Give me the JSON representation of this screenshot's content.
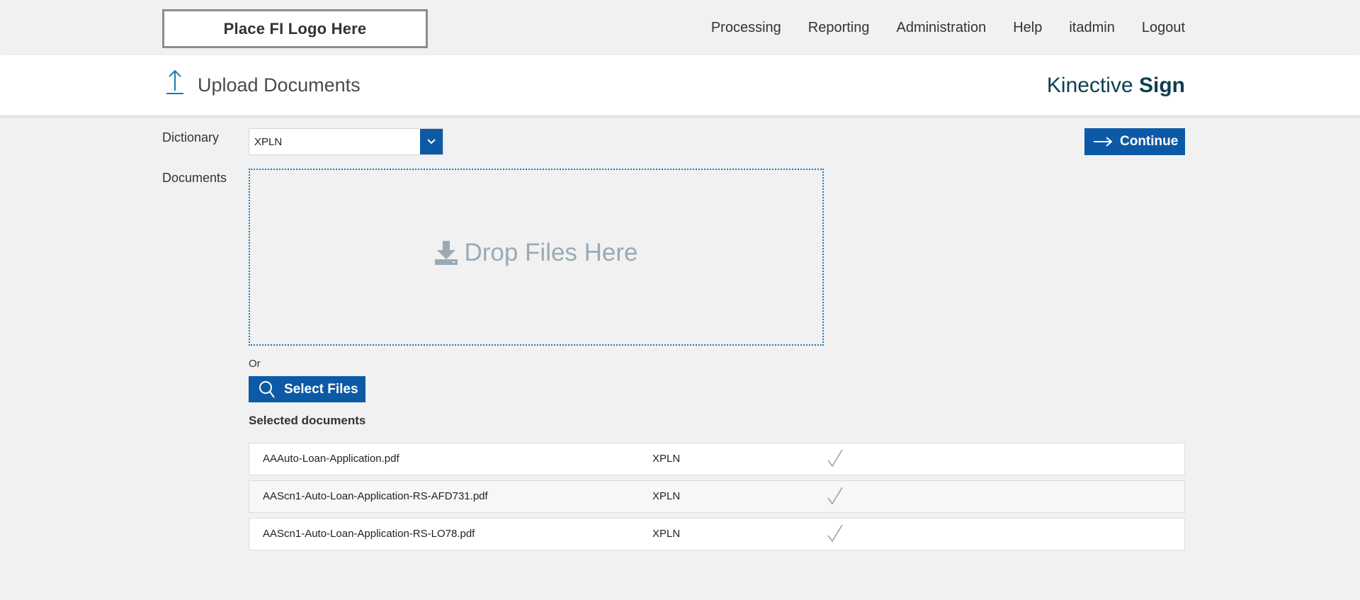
{
  "header": {
    "logo_text": "Place FI Logo Here",
    "nav": [
      "Processing",
      "Reporting",
      "Administration",
      "Help",
      "itadmin",
      "Logout"
    ]
  },
  "titlebar": {
    "title": "Upload Documents",
    "brand_regular": "Kinective ",
    "brand_bold": "Sign"
  },
  "form": {
    "dictionary_label": "Dictionary",
    "dictionary_value": "XPLN",
    "documents_label": "Documents",
    "continue_label": "Continue",
    "drop_text": "Drop Files Here",
    "or_text": "Or",
    "select_files_label": "Select Files",
    "selected_title": "Selected documents"
  },
  "documents": [
    {
      "name": "AAAuto-Loan-Application.pdf",
      "dictionary": "XPLN"
    },
    {
      "name": "AAScn1-Auto-Loan-Application-RS-AFD731.pdf",
      "dictionary": "XPLN"
    },
    {
      "name": "AAScn1-Auto-Loan-Application-RS-LO78.pdf",
      "dictionary": "XPLN"
    }
  ],
  "colors": {
    "primary": "#0c5aa6",
    "brand": "#0d3f4e",
    "drop_text": "#9aaab4"
  }
}
